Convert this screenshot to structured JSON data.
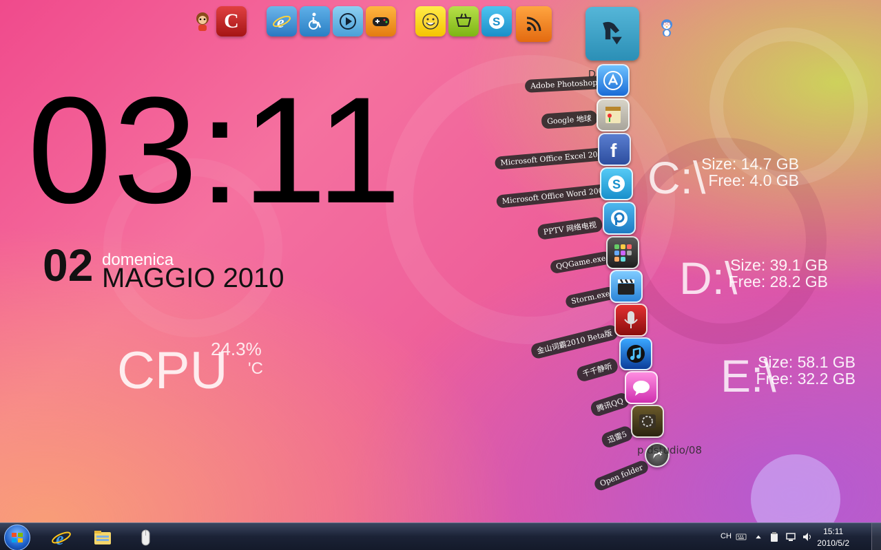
{
  "dock": {
    "icons": [
      "monkey-mascot-icon",
      "c-app-icon",
      "internet-explorer-icon",
      "accessibility-icon",
      "media-player-icon",
      "gamepad-icon",
      "smiley-icon",
      "shopping-icon",
      "skype-icon",
      "rss-icon",
      "download-icon",
      "penguin-mascot-icon"
    ],
    "label": "D            l"
  },
  "clock": {
    "time": "03:11"
  },
  "date": {
    "day": "02",
    "weekday": "domenica",
    "month_year": "MAGGIO 2010"
  },
  "cpu": {
    "label": "CPU",
    "value": "24.3%",
    "temp_unit": "'C"
  },
  "drives": [
    {
      "letter": "C:\\",
      "size": "Size: 14.7 GB",
      "free": "Free: 4.0 GB"
    },
    {
      "letter": "D:\\",
      "size": "Size: 39.1 GB",
      "free": "Free: 28.2 GB"
    },
    {
      "letter": "E:\\",
      "size": "Size: 58.1 GB",
      "free": "Free: 32.2 GB"
    }
  ],
  "stack": {
    "items": [
      {
        "label": "Adobe Photoshop",
        "icon": "app-store-icon"
      },
      {
        "label": "Google 地球",
        "icon": "apple-notes-icon"
      },
      {
        "label": "Microsoft Office Excel 2007",
        "icon": "facebook-icon"
      },
      {
        "label": "Microsoft Office Word 2007",
        "icon": "skype-icon"
      },
      {
        "label": "PPTV 网络电视",
        "icon": "pptv-icon"
      },
      {
        "label": "QQGame.exe",
        "icon": "app-grid-icon"
      },
      {
        "label": "Storm.exe",
        "icon": "clapperboard-icon"
      },
      {
        "label": "金山词霸2010 Beta版",
        "icon": "microphone-icon"
      },
      {
        "label": "千千静听",
        "icon": "itunes-icon"
      },
      {
        "label": "腾讯QQ",
        "icon": "messages-icon"
      },
      {
        "label": "迅雷5",
        "icon": "thunder-icon"
      },
      {
        "label": "Open folder",
        "icon": "open-folder-arrow-icon"
      }
    ],
    "footer": "p        dstudio/08"
  },
  "taskbar": {
    "pinned": [
      "internet-explorer-icon",
      "file-explorer-icon",
      "mouse-icon"
    ],
    "ime": "CH",
    "time": "15:11",
    "date": "2010/5/2"
  }
}
